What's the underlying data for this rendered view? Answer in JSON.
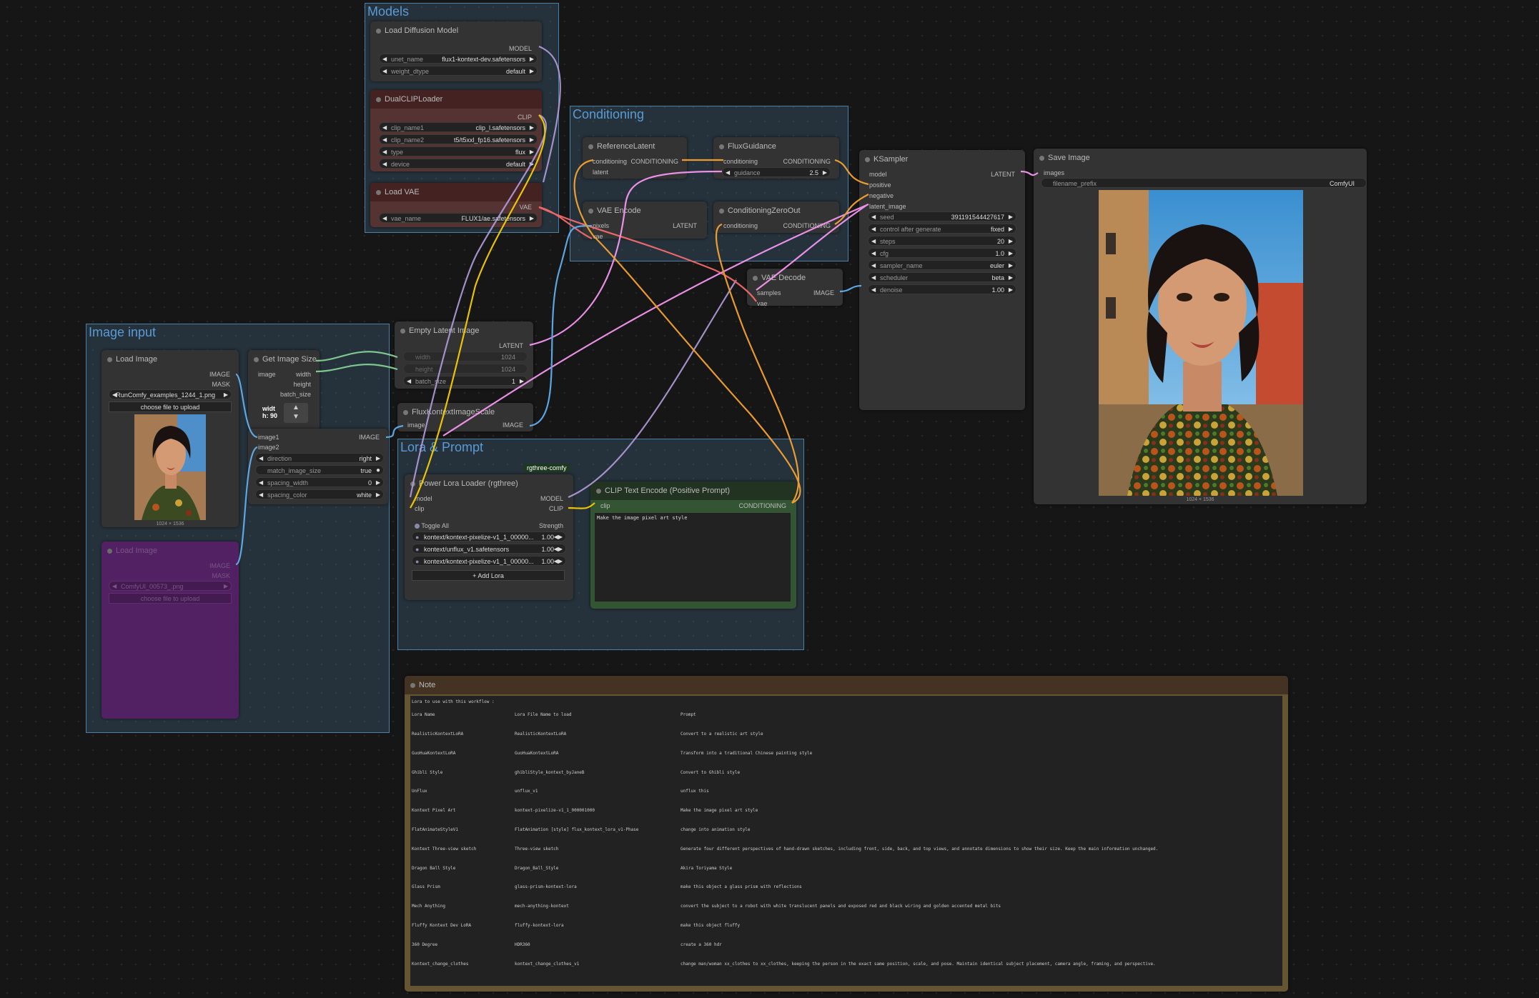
{
  "groups": {
    "models": "Models",
    "conditioning": "Conditioning",
    "image_input": "Image input",
    "lora_prompt": "Lora & Prompt"
  },
  "colors": {
    "accent": "#5b9bd5",
    "model_wire": "#b39ddb",
    "clip_wire": "#ffd500",
    "vae_wire": "#ff6e6e",
    "latent_wire": "#ff9cf9",
    "image_wire": "#64b5f6",
    "conditioning_wire": "#ffa931"
  },
  "load_diffusion_model": {
    "title": "Load Diffusion Model",
    "output": "MODEL",
    "unet_label": "unet_name",
    "unet_value": "flux1-kontext-dev.safetensors",
    "weight_label": "weight_dtype",
    "weight_value": "default"
  },
  "dual_clip": {
    "title": "DualCLIPLoader",
    "output": "CLIP",
    "clip1_label": "clip_name1",
    "clip1_value": "clip_l.safetensors",
    "clip2_label": "clip_name2",
    "clip2_value": "t5/t5xxl_fp16.safetensors",
    "type_label": "type",
    "type_value": "flux",
    "device_label": "device",
    "device_value": "default"
  },
  "load_vae": {
    "title": "Load VAE",
    "output": "VAE",
    "vae_label": "vae_name",
    "vae_value": "FLUX1/ae.safetensors"
  },
  "reference_latent": {
    "title": "ReferenceLatent",
    "in1": "conditioning",
    "in2": "latent",
    "out": "CONDITIONING"
  },
  "flux_guidance": {
    "title": "FluxGuidance",
    "in": "conditioning",
    "out": "CONDITIONING",
    "g_label": "guidance",
    "g_value": "2.5"
  },
  "vae_encode": {
    "title": "VAE Encode",
    "in1": "pixels",
    "in2": "vae",
    "out": "LATENT"
  },
  "cond_zero": {
    "title": "ConditioningZeroOut",
    "in": "conditioning",
    "out": "CONDITIONING"
  },
  "vae_decode": {
    "title": "VAE Decode",
    "in1": "samples",
    "in2": "vae",
    "out": "IMAGE"
  },
  "ksampler": {
    "title": "KSampler",
    "in1": "model",
    "in2": "positive",
    "in3": "negative",
    "in4": "latent_image",
    "out": "LATENT",
    "widgets": [
      {
        "label": "seed",
        "value": "391191544427617"
      },
      {
        "label": "control after generate",
        "value": "fixed"
      },
      {
        "label": "steps",
        "value": "20"
      },
      {
        "label": "cfg",
        "value": "1.0"
      },
      {
        "label": "sampler_name",
        "value": "euler"
      },
      {
        "label": "scheduler",
        "value": "beta"
      },
      {
        "label": "denoise",
        "value": "1.00"
      }
    ]
  },
  "save_image": {
    "title": "Save Image",
    "in": "images",
    "prefix_label": "filename_prefix",
    "prefix_value": "ComfyUI",
    "size": "1024 × 1536"
  },
  "load_image": {
    "title": "Load Image",
    "out1": "IMAGE",
    "out2": "MASK",
    "file": "RunComfy_examples_1244_1.png",
    "upload": "choose file to upload",
    "size": "1024 × 1536"
  },
  "load_image2": {
    "title": "Load Image",
    "out1": "IMAGE",
    "out2": "MASK",
    "file": "ComfyUI_00573_.png",
    "upload": "choose file to upload"
  },
  "get_image_size": {
    "title": "Get Image Size",
    "in": "image",
    "out1": "width",
    "out2": "height",
    "out3": "batch_size",
    "w_label": "widt",
    "h_label": "h: 90"
  },
  "stitch": {
    "in1": "image1",
    "in2": "image2",
    "out": "IMAGE",
    "widgets": [
      {
        "label": "direction",
        "value": "right"
      },
      {
        "label": "match_image_size",
        "value": "true"
      },
      {
        "label": "spacing_width",
        "value": "0"
      },
      {
        "label": "spacing_color",
        "value": "white"
      }
    ]
  },
  "empty_latent": {
    "title": "Empty Latent Image",
    "out": "LATENT",
    "w_label": "width",
    "w_value": "1024",
    "h_label": "height",
    "h_value": "1024",
    "b_label": "batch_size",
    "b_value": "1"
  },
  "flux_scale": {
    "title": "FluxKontextImageScale",
    "in": "image",
    "out": "IMAGE"
  },
  "power_lora": {
    "badge": "rgthree-comfy",
    "title": "Power Lora Loader (rgthree)",
    "in1": "model",
    "in2": "clip",
    "out1": "MODEL",
    "out2": "CLIP",
    "toggle": "Toggle All",
    "strength": "Strength",
    "loras": [
      {
        "name": "kontext/kontext-pixelize-v1_1_00000...",
        "value": "1.00"
      },
      {
        "name": "kontext/unflux_v1.safetensors",
        "value": "1.00"
      },
      {
        "name": "kontext/kontext-pixelize-v1_1_00000...",
        "value": "1.00"
      }
    ],
    "add": "+ Add Lora"
  },
  "clip_text": {
    "title": "CLIP Text Encode (Positive Prompt)",
    "in": "clip",
    "out": "CONDITIONING",
    "text": "Make the image pixel art style"
  },
  "note": {
    "title": "Note",
    "intro": "Lora to use with this workflow :",
    "headers": [
      "Lora Name",
      "Lora File Name to load",
      "Prompt"
    ],
    "rows": [
      [
        "RealisticKontextLoRA",
        "RealisticKontextLoRA",
        "Convert to a realistic art style"
      ],
      [
        "GuoHuaKontextLoRA",
        "GuoHuaKontextLoRA",
        "Transform into a traditional Chinese painting style"
      ],
      [
        "Ghibli Style",
        "ghibliStyle_kontext_byJaneB",
        "Convert to Ghibli style"
      ],
      [
        "UnFlux",
        "unflux_v1",
        "unflux this"
      ],
      [
        "Kontext Pixel Art",
        "kontext-pixelize-v1_1_000001000",
        "Make the image pixel art style"
      ],
      [
        "FlatAnimateStyleV1",
        "FlatAnimation [style] flux_kontext_lora_v1-Phase",
        "change into animation style"
      ],
      [
        "Kontext Three-view sketch",
        "Three-view sketch",
        "Generate four different perspectives of hand-drawn sketches, including front, side, back, and top views, and annotate dimensions to show their size. Keep the main information unchanged."
      ],
      [
        "Dragon Ball Style",
        "Dragon_Ball_Style",
        "Akira Toriyama Style"
      ],
      [
        "Glass Prism",
        "glass-prism-kontext-lora",
        "make this object a glass prism with reflections"
      ],
      [
        "Mech Anything",
        "mech-anything-kontext",
        "convert the subject to a robot with white translucent panels and exposed red and black wiring and golden accented metal bits"
      ],
      [
        "Fluffy Kontext Dev LoRA",
        "fluffy-kontext-lora",
        "make this object fluffy"
      ],
      [
        "360 Degree",
        "HDR360",
        "create a 360 hdr"
      ],
      [
        "Kontext_change_clothes",
        "kontext_change_clothes_v1",
        "change man/woman xx_clothes to xx_clothes, keeping the person in the exact same position, scale, and pose. Maintain identical subject placement, camera angle, framing, and perspective."
      ]
    ]
  }
}
